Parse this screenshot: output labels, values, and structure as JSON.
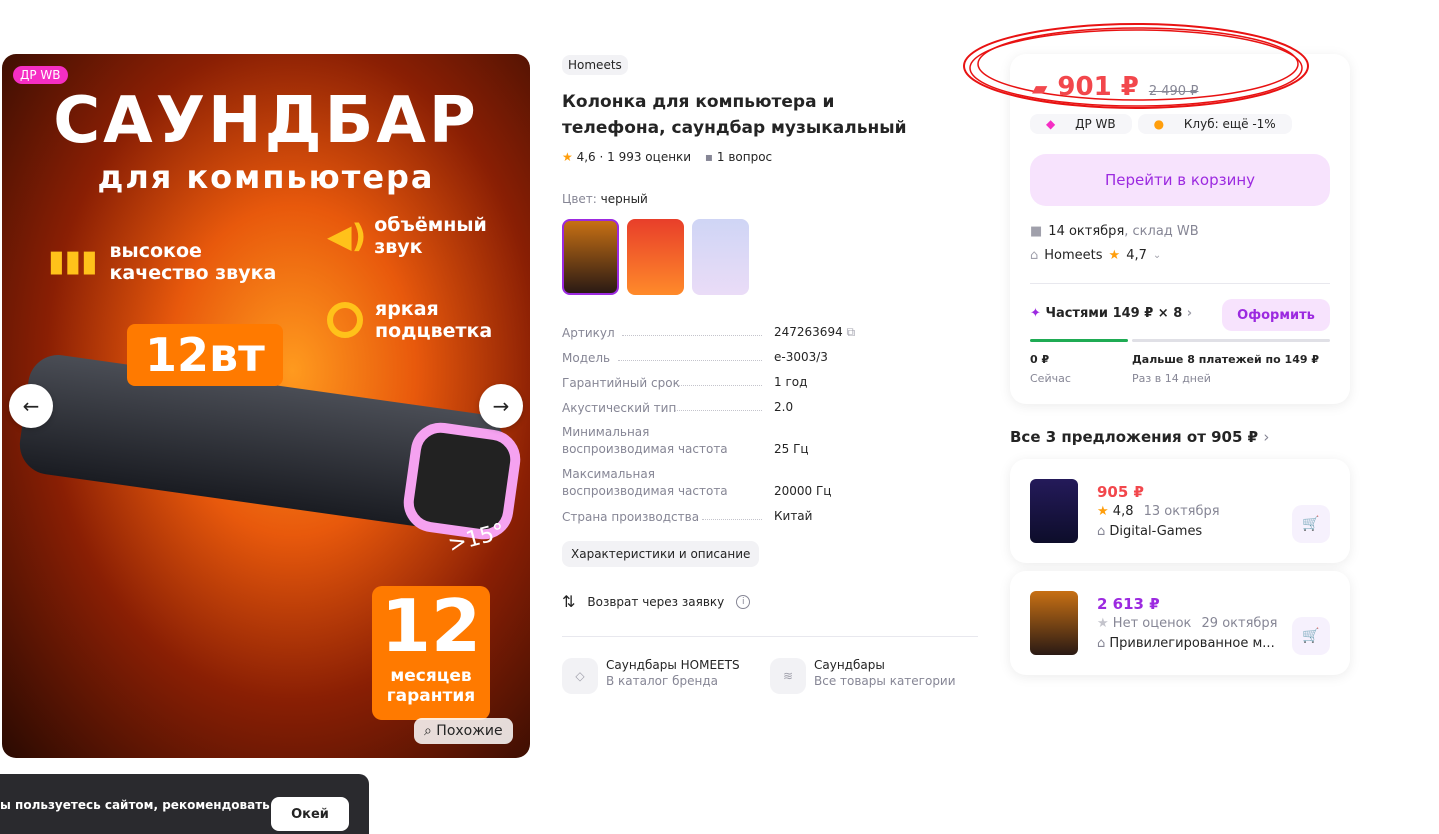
{
  "hero": {
    "badge": "ДР WB",
    "title": "САУНДБАР",
    "subtitle": "для компьютера",
    "feature_sound_quality": "высокое\nкачество звука",
    "feature_surround": "объёмный\nзвук",
    "feature_light": "яркая\nподцветка",
    "power": "12вт",
    "angle": ">15°",
    "warranty_number": "12",
    "warranty_text": "месяцев\nгарантия",
    "similar_label": "Похожие"
  },
  "product": {
    "brand": "Homeets",
    "title": "Колонка для компьютера и телефона, саундбар музыкальный",
    "rating": "4,6",
    "reviews": "1 993 оценки",
    "questions": "1 вопрос",
    "color_label": "Цвет:",
    "color_value": "черный",
    "specs": [
      {
        "k": "Артикул",
        "v": "247263694"
      },
      {
        "k": "Модель",
        "v": "e-3003/3"
      },
      {
        "k": "Гарантийный срок",
        "v": "1 год"
      },
      {
        "k": "Акустический тип",
        "v": "2.0"
      },
      {
        "k": "Минимальная воспроизводимая частота",
        "v": "25 Гц"
      },
      {
        "k": "Максимальная воспроизводимая частота",
        "v": "20000 Гц"
      },
      {
        "k": "Страна производства",
        "v": "Китай"
      }
    ],
    "details_button": "Характеристики и описание",
    "return_text": "Возврат через заявку",
    "brand_catalog_title": "Саундбары HOMEETS",
    "brand_catalog_sub": "В каталог бренда",
    "category_title": "Саундбары",
    "category_sub": "Все товары категории"
  },
  "buy": {
    "price": "901 ₽",
    "old_price": "2 490 ₽",
    "tag_wb": "ДР WB",
    "tag_club": "Клуб: ещё -1%",
    "cart_button": "Перейти в корзину",
    "delivery_date": "14 октября",
    "delivery_store": ", склад WB",
    "seller": "Homeets",
    "seller_rating": "4,7",
    "installments": "Частями 149 ₽ × 8",
    "installments_button": "Оформить",
    "pay_now": "0 ₽",
    "pay_now_sub": "Сейчас",
    "pay_later": "Дальше 8 платежей по 149 ₽",
    "pay_later_sub": "Раз в 14 дней"
  },
  "offers": {
    "header": "Все 3 предложения от 905 ₽",
    "items": [
      {
        "price": "905 ₽",
        "rating": "4,8",
        "date": "13 октября",
        "seller": "Digital-Games",
        "color": "#f2474c"
      },
      {
        "price": "2 613 ₽",
        "rating": "Нет оценок",
        "date": "29 октября",
        "seller": "Привилегированное м...",
        "color": "#9c2ae0"
      }
    ]
  },
  "cookie": {
    "text": "ы пользуетесь сайтом, рекомендовать",
    "ok": "Окей"
  },
  "colors": {
    "accent": "#9c2ae0",
    "price_red": "#f2474c",
    "wb_pink": "#f52ec4"
  }
}
